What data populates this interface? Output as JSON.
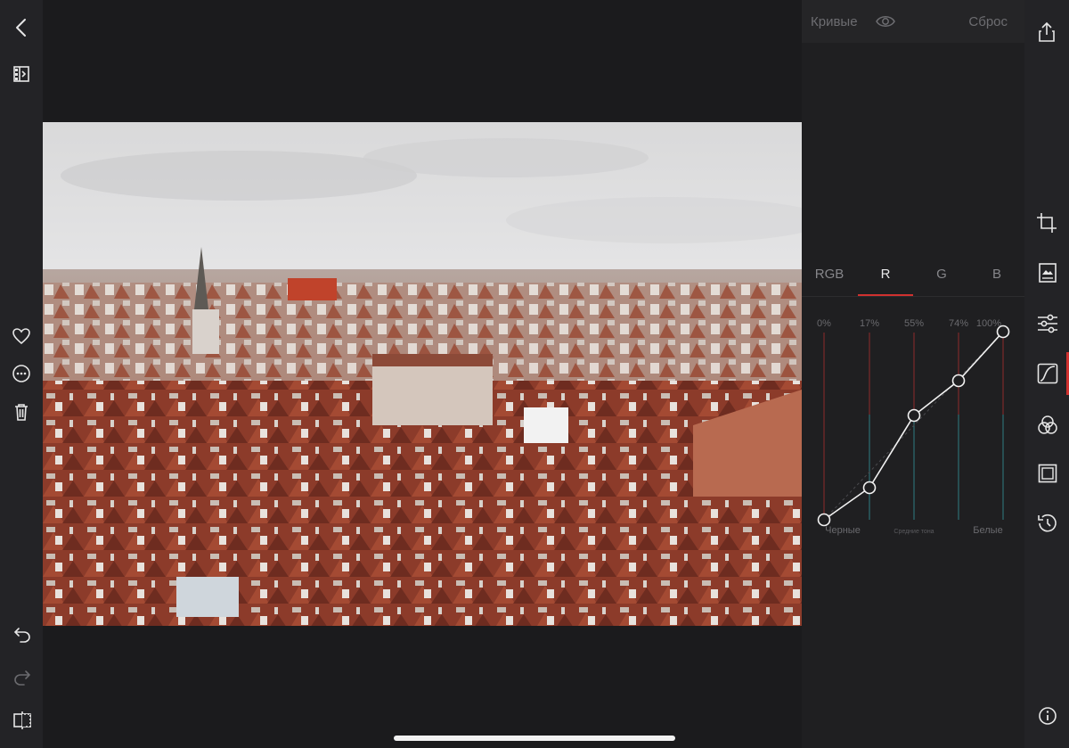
{
  "left_toolbar": {
    "icons": [
      "back-chevron-icon",
      "compare-split-icon",
      "heart-icon",
      "more-icon",
      "trash-icon",
      "undo-icon",
      "redo-icon",
      "split-view-icon"
    ]
  },
  "right_toolbar": {
    "icons": [
      "share-icon",
      "crop-icon",
      "presets-icon",
      "sliders-icon",
      "curves-icon",
      "color-mix-icon",
      "vignette-frame-icon",
      "history-icon",
      "info-icon"
    ],
    "active": "curves-icon",
    "accent_color": "#d0312f"
  },
  "photo": {
    "description_icon": "photo-prague-rooftops"
  },
  "curves_panel": {
    "title": "Кривые",
    "reset_label": "Сброс",
    "tabs": [
      "RGB",
      "R",
      "G",
      "B"
    ],
    "active_tab": "R",
    "percent_labels": [
      "0%",
      "17%",
      "55%",
      "74%",
      "100%"
    ],
    "bottom_labels": {
      "blacks": "Черные",
      "midtones": "Средние тона",
      "whites": "Белые"
    },
    "curve_points": [
      {
        "input": 0,
        "output": 0
      },
      {
        "input": 17,
        "output": 17
      },
      {
        "input": 55,
        "output": 55
      },
      {
        "input": 74,
        "output": 74
      },
      {
        "input": 100,
        "output": 100
      }
    ]
  }
}
